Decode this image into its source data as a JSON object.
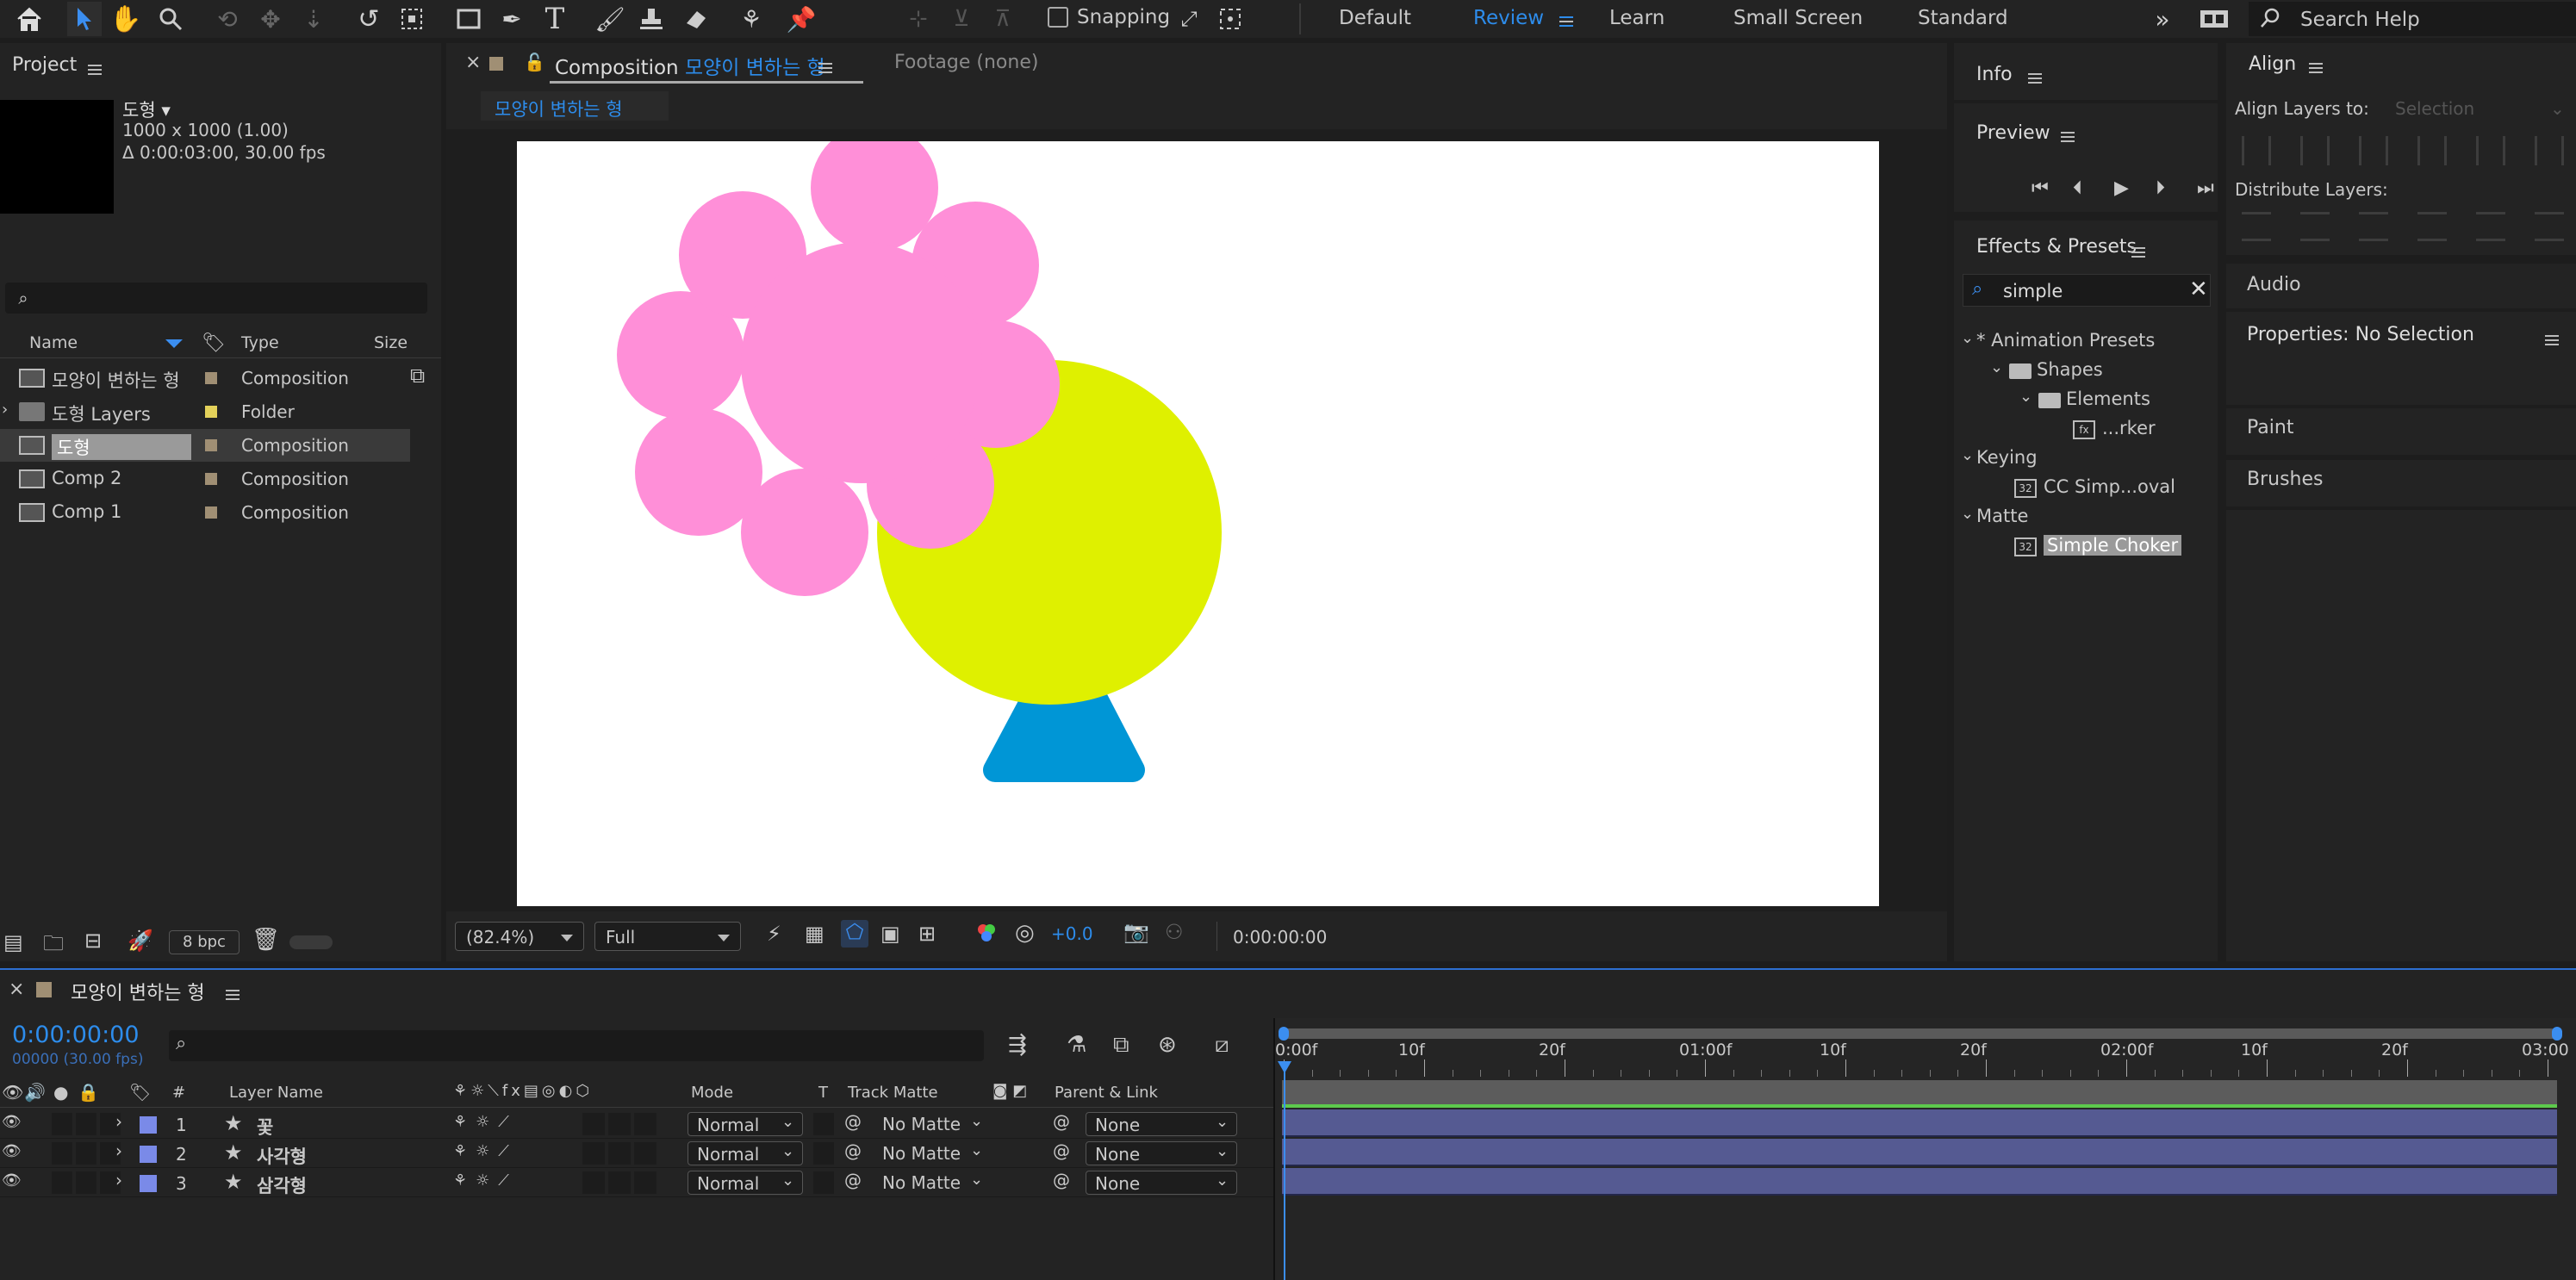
{
  "toolbar": {
    "tools": [
      "home-icon",
      "selection-tool-icon",
      "hand-tool-icon",
      "zoom-tool-icon",
      "orbit-camera-icon",
      "pan-camera-icon",
      "dolly-camera-icon",
      "rotation-tool-icon",
      "pan-behind-icon",
      "rectangle-tool-icon",
      "pen-tool-icon",
      "type-tool-icon",
      "brush-tool-icon",
      "clone-stamp-icon",
      "eraser-tool-icon",
      "roto-brush-icon",
      "puppet-pin-icon"
    ],
    "snapping_label": "Snapping",
    "workspaces": [
      "Default",
      "Review",
      "Learn",
      "Small Screen",
      "Standard"
    ],
    "active_workspace": "Review",
    "search_placeholder": "Search Help"
  },
  "project": {
    "title": "Project",
    "selected_name": "도형",
    "selected_info1": "1000 x 1000 (1.00)",
    "selected_info2": "Δ 0:00:03:00, 30.00 fps",
    "columns": {
      "name": "Name",
      "type": "Type",
      "size": "Size"
    },
    "items": [
      {
        "name": "모양이 변하는 형",
        "type": "Composition",
        "color": "#a08f74",
        "kind": "comp"
      },
      {
        "name": "도형 Layers",
        "type": "Folder",
        "color": "#e3d15a",
        "kind": "folder"
      },
      {
        "name": "도형",
        "type": "Composition",
        "color": "#a08f74",
        "kind": "comp"
      },
      {
        "name": "Comp 2",
        "type": "Composition",
        "color": "#a08f74",
        "kind": "comp"
      },
      {
        "name": "Comp 1",
        "type": "Composition",
        "color": "#a08f74",
        "kind": "comp"
      }
    ],
    "bpc": "8 bpc"
  },
  "composition": {
    "tab_prefix": "Composition",
    "tab_name": "모양이 변하는 형",
    "footage_tab": "Footage (none)",
    "breadcrumb": "모양이 변하는 형",
    "zoom": "(82.4%)",
    "resolution": "Full",
    "exposure": "+0.0",
    "timecode": "0:00:00:00",
    "colors": {
      "pink": "#ff8fd8",
      "yellow": "#dff000",
      "blue": "#0096d6"
    }
  },
  "info": {
    "title": "Info"
  },
  "preview": {
    "title": "Preview"
  },
  "effects": {
    "title": "Effects & Presets",
    "search_value": "simple",
    "tree": [
      {
        "label": "* Animation Presets",
        "level": 0,
        "kind": "group"
      },
      {
        "label": "Shapes",
        "level": 1,
        "kind": "folder"
      },
      {
        "label": "Elements",
        "level": 2,
        "kind": "folder"
      },
      {
        "label": "...rker",
        "level": 3,
        "kind": "preset"
      },
      {
        "label": "Keying",
        "level": 0,
        "kind": "group"
      },
      {
        "label": "CC Simp...oval",
        "level": 1,
        "kind": "effect"
      },
      {
        "label": "Matte",
        "level": 0,
        "kind": "group"
      },
      {
        "label": "Simple Choker",
        "level": 1,
        "kind": "effect",
        "selected": true
      }
    ]
  },
  "align": {
    "title": "Align",
    "align_to_label": "Align Layers to:",
    "align_to_value": "Selection",
    "distribute_label": "Distribute Layers:"
  },
  "right_panels": {
    "audio": "Audio",
    "properties": "Properties: No Selection",
    "paint": "Paint",
    "brushes": "Brushes"
  },
  "timeline": {
    "comp_name": "모양이 변하는 형",
    "timecode": "0:00:00:00",
    "frames": "00000 (30.00 fps)",
    "columns": {
      "num": "#",
      "layer_name": "Layer Name",
      "mode": "Mode",
      "t": "T",
      "track_matte": "Track Matte",
      "parent": "Parent & Link"
    },
    "layers": [
      {
        "num": "1",
        "name": "꽃",
        "mode": "Normal",
        "matte": "No Matte",
        "parent": "None"
      },
      {
        "num": "2",
        "name": "사각형",
        "mode": "Normal",
        "matte": "No Matte",
        "parent": "None"
      },
      {
        "num": "3",
        "name": "삼각형",
        "mode": "Normal",
        "matte": "No Matte",
        "parent": "None"
      }
    ],
    "ruler": [
      "0:00f",
      "10f",
      "20f",
      "01:00f",
      "10f",
      "20f",
      "02:00f",
      "10f",
      "20f",
      "03:00"
    ],
    "layer_color": "#7a8ae8"
  }
}
